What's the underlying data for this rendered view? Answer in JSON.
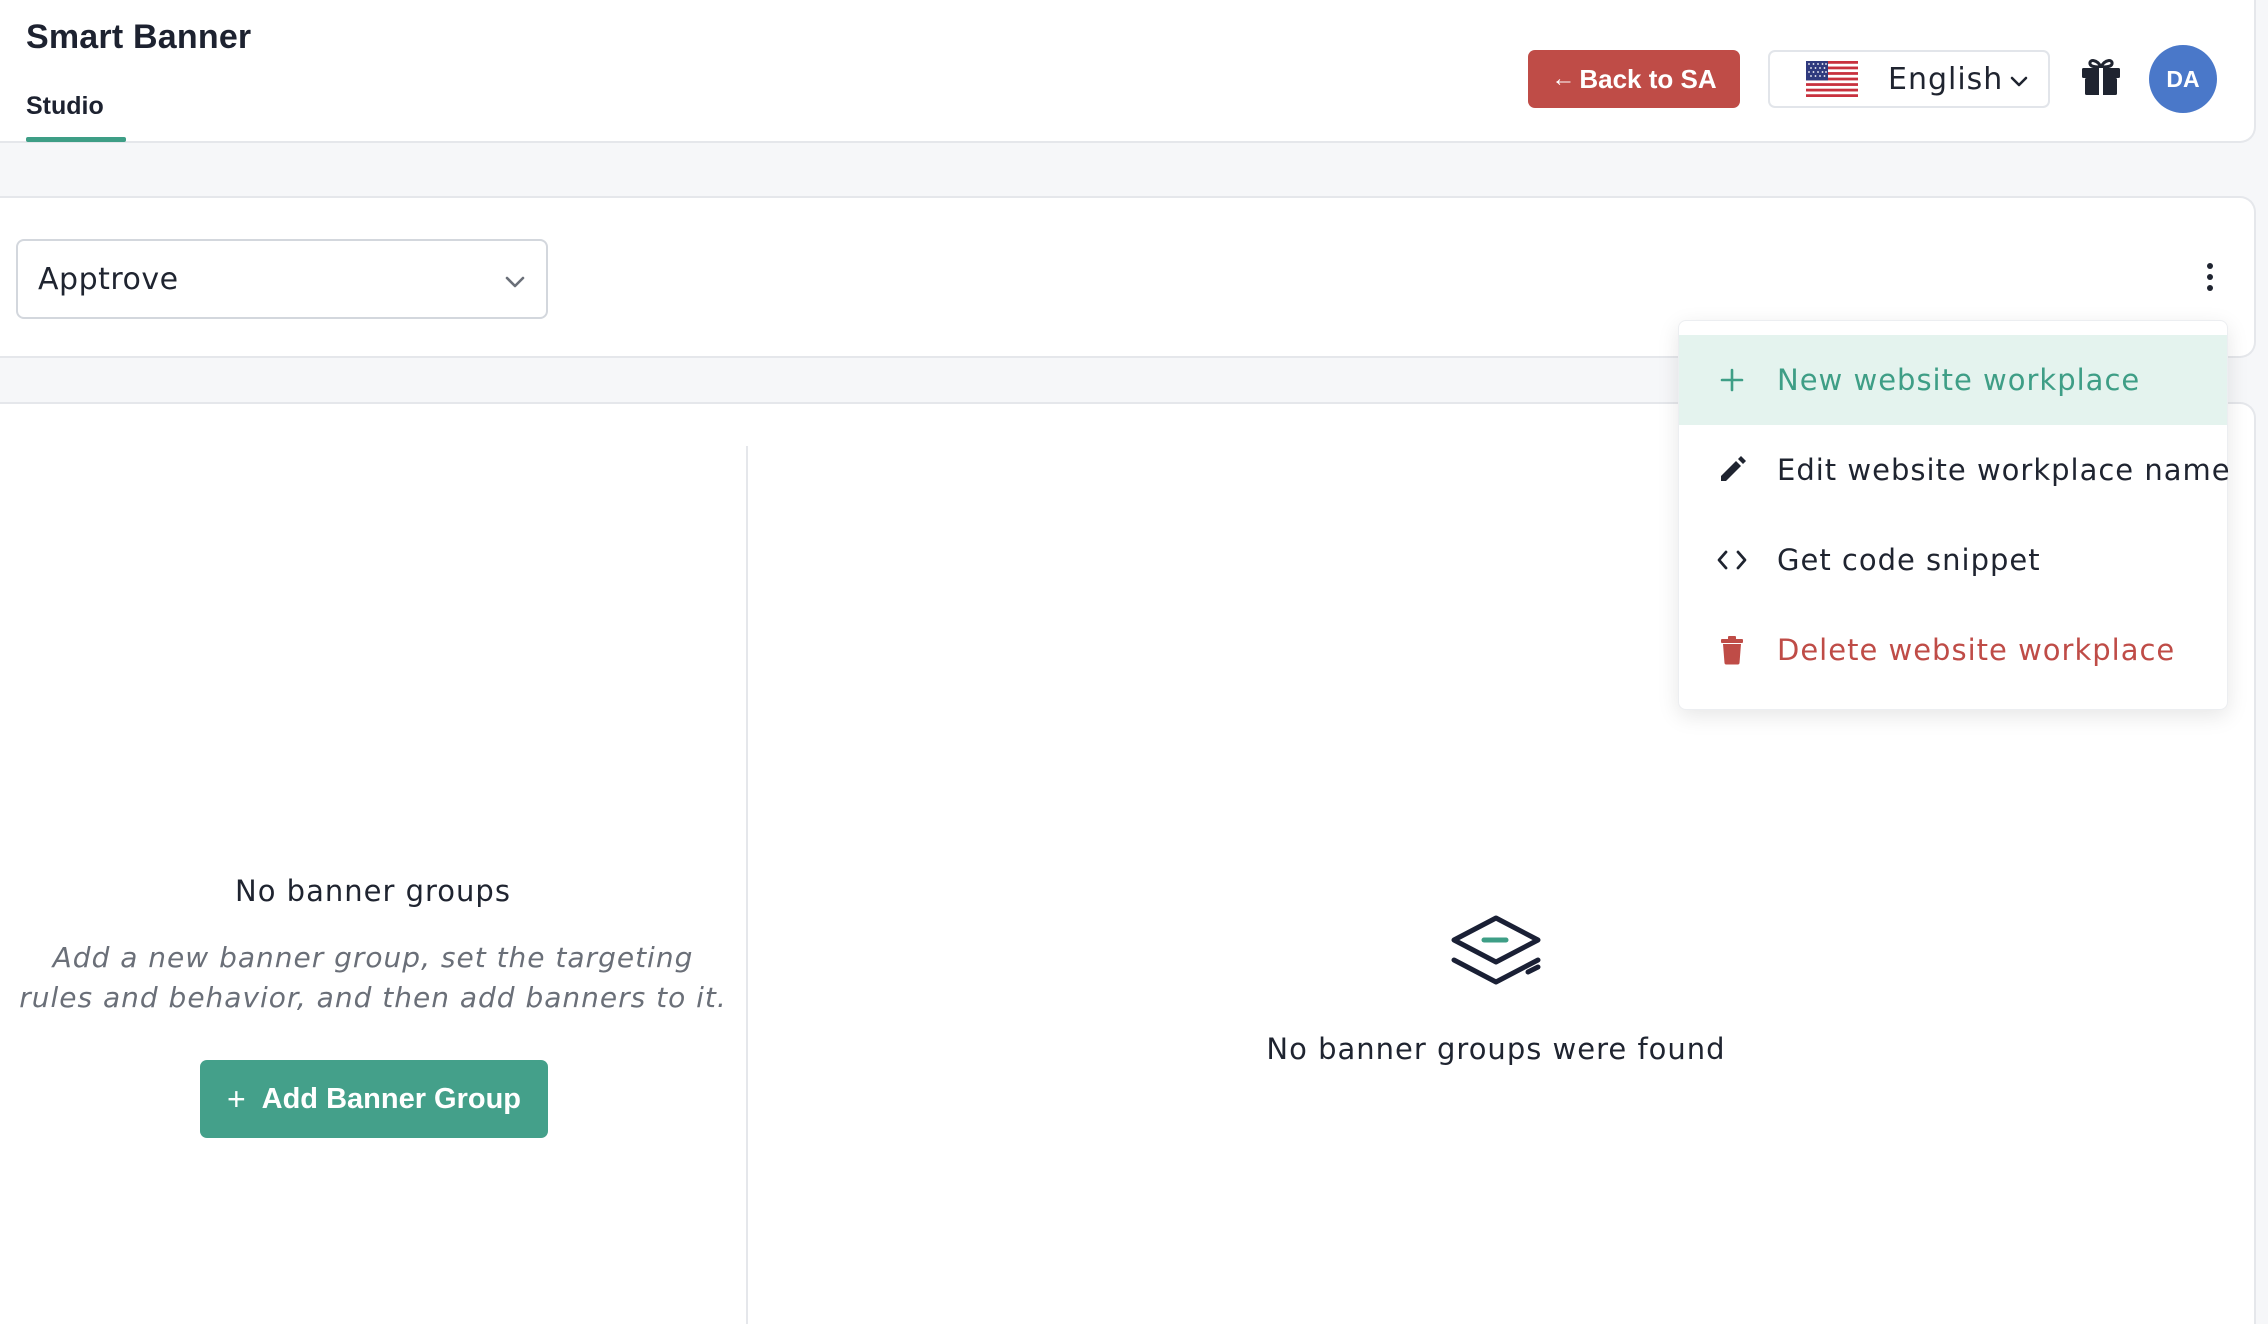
{
  "header": {
    "app_title": "Smart Banner",
    "tabs": [
      {
        "label": "Studio",
        "active": true
      }
    ],
    "back_button": {
      "label": "Back to SA",
      "icon": "arrow-left-icon"
    },
    "language": {
      "selected": "English",
      "flag": "us-flag-icon"
    },
    "gift_icon": "gift-icon",
    "avatar_initials": "DA"
  },
  "workplace": {
    "selected": "Apptrove",
    "more_icon": "kebab-menu-icon"
  },
  "menu": {
    "items": [
      {
        "label": "New website workplace",
        "icon": "plus-icon",
        "state": "hover"
      },
      {
        "label": "Edit website workplace name",
        "icon": "pencil-icon",
        "state": "default"
      },
      {
        "label": "Get code snippet",
        "icon": "code-icon",
        "state": "default"
      },
      {
        "label": "Delete website workplace",
        "icon": "trash-icon",
        "state": "danger"
      }
    ]
  },
  "groups_panel": {
    "empty_title": "No banner groups",
    "empty_description": "Add a new banner group, set the targeting rules and behavior, and then add banners to it.",
    "add_button_label": "Add Banner Group"
  },
  "detail_panel": {
    "empty_title": "No banner groups were found",
    "icon": "layers-icon"
  },
  "colors": {
    "accent_green": "#44a08a",
    "danger_red": "#bf4c47",
    "avatar_blue": "#4a78c9",
    "menu_hover": "#e4f3ee"
  }
}
